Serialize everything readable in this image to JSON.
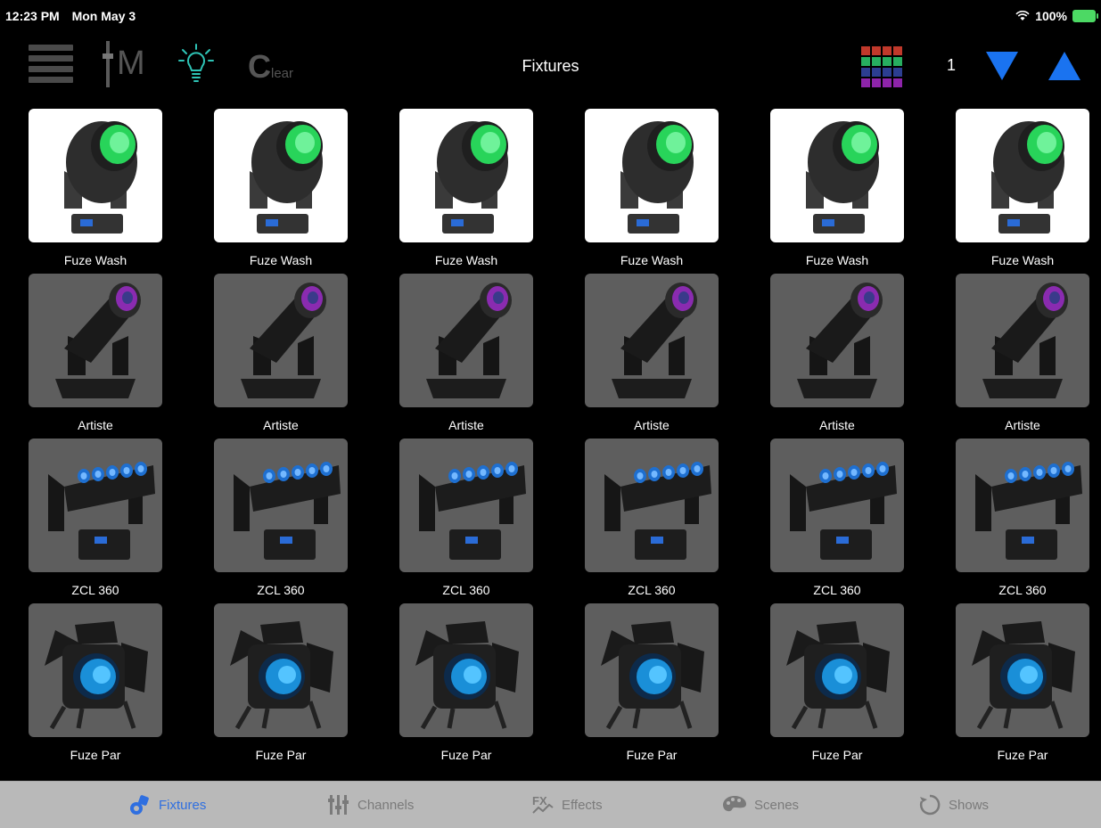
{
  "status_bar": {
    "time": "12:23 PM",
    "date": "Mon May 3",
    "battery": "100%"
  },
  "toolbar": {
    "title": "Fixtures",
    "clear_big": "C",
    "clear_small": "lear",
    "master_letter": "M",
    "page_number": "1"
  },
  "grid_colors": [
    "#c0392b",
    "#c0392b",
    "#c0392b",
    "#c0392b",
    "#27ae60",
    "#27ae60",
    "#27ae60",
    "#27ae60",
    "#2c3e91",
    "#2c3e91",
    "#2c3e91",
    "#2c3e91",
    "#8e24aa",
    "#8e24aa",
    "#8e24aa",
    "#8e24aa"
  ],
  "colors": {
    "accent": "#1a73f0",
    "tab_active": "#2f6fe0",
    "selected_tile_bg": "#ffffff",
    "inactive_tile_bg": "#5e5e5e"
  },
  "fixture_rows": [
    {
      "label": "Fuze Wash",
      "icon": "fuze-wash-icon",
      "selected": true
    },
    {
      "label": "Artiste",
      "icon": "artiste-icon",
      "selected": false
    },
    {
      "label": "ZCL 360",
      "icon": "zcl-360-icon",
      "selected": false
    },
    {
      "label": "Fuze Par",
      "icon": "fuze-par-icon",
      "selected": false
    }
  ],
  "fixtures": [
    {
      "label": "Fuze Wash"
    },
    {
      "label": "Fuze Wash"
    },
    {
      "label": "Fuze Wash"
    },
    {
      "label": "Fuze Wash"
    },
    {
      "label": "Fuze Wash"
    },
    {
      "label": "Fuze Wash"
    },
    {
      "label": "Artiste"
    },
    {
      "label": "Artiste"
    },
    {
      "label": "Artiste"
    },
    {
      "label": "Artiste"
    },
    {
      "label": "Artiste"
    },
    {
      "label": "Artiste"
    },
    {
      "label": "ZCL 360"
    },
    {
      "label": "ZCL 360"
    },
    {
      "label": "ZCL 360"
    },
    {
      "label": "ZCL 360"
    },
    {
      "label": "ZCL 360"
    },
    {
      "label": "ZCL 360"
    },
    {
      "label": "Fuze Par"
    },
    {
      "label": "Fuze Par"
    },
    {
      "label": "Fuze Par"
    },
    {
      "label": "Fuze Par"
    },
    {
      "label": "Fuze Par"
    },
    {
      "label": "Fuze Par"
    }
  ],
  "tabs": [
    {
      "label": "Fixtures",
      "icon": "fixtures-tab-icon",
      "active": true
    },
    {
      "label": "Channels",
      "icon": "channels-tab-icon",
      "active": false
    },
    {
      "label": "Effects",
      "icon": "effects-tab-icon",
      "active": false
    },
    {
      "label": "Scenes",
      "icon": "scenes-tab-icon",
      "active": false
    },
    {
      "label": "Shows",
      "icon": "shows-tab-icon",
      "active": false
    }
  ]
}
